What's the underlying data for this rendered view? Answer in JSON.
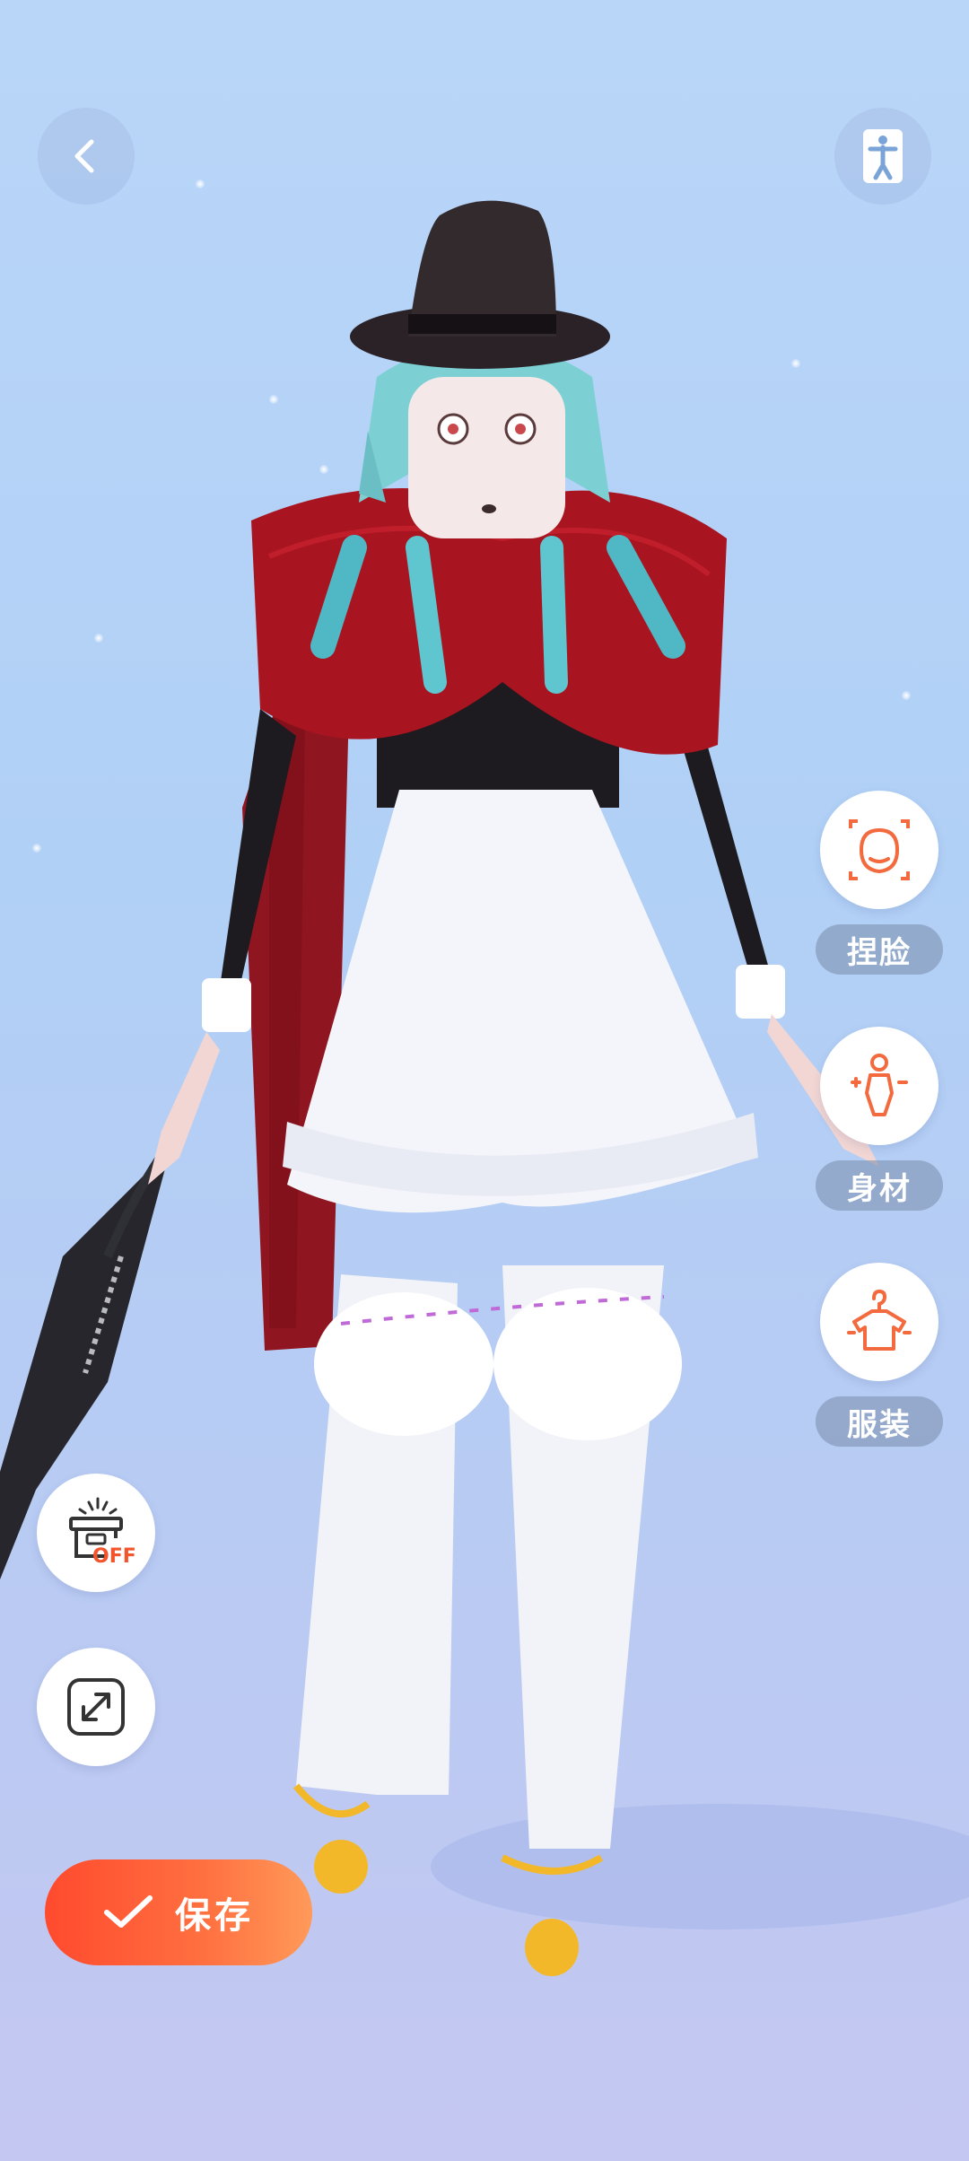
{
  "top_bar": {
    "back_icon": "chevron-left-icon",
    "pose_icon": "person-pose-icon"
  },
  "side_menu": {
    "items": [
      {
        "label": "捏脸",
        "icon": "face-icon"
      },
      {
        "label": "身材",
        "icon": "body-icon"
      },
      {
        "label": "服装",
        "icon": "clothes-hanger-icon"
      }
    ]
  },
  "tools": {
    "backdrop_toggle_badge": "OFF",
    "backdrop_icon": "light-box-icon",
    "expand_icon": "expand-icon"
  },
  "save_button": {
    "label": "保存",
    "icon": "check-icon"
  },
  "colors": {
    "accent": "#ff5a33",
    "icon_orange": "#f26a3d",
    "background_top": "#b9d6f8",
    "background_bottom": "#c4c7f2"
  }
}
